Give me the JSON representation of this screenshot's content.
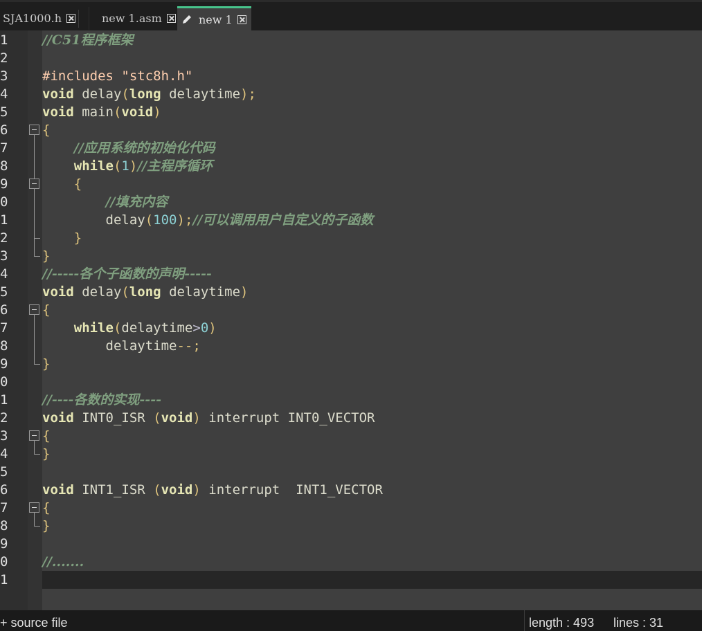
{
  "tabs": [
    {
      "label": "SJA1000.h",
      "active": false
    },
    {
      "label": "new 1.asm",
      "active": false
    },
    {
      "label": "new 1",
      "active": true
    }
  ],
  "editor": {
    "line_numbers": [
      "1",
      "2",
      "3",
      "4",
      "5",
      "6",
      "7",
      "8",
      "9",
      "0",
      "1",
      "2",
      "3",
      "4",
      "5",
      "6",
      "7",
      "8",
      "9",
      "0",
      "1",
      "2",
      "3",
      "4",
      "5",
      "6",
      "7",
      "8",
      "9",
      "0",
      "1"
    ],
    "lines": [
      [
        {
          "t": "//C51程序框架",
          "c": "cmserif"
        }
      ],
      [],
      [
        {
          "t": "#includes ",
          "c": "pp"
        },
        {
          "t": "\"stc8h.h\"",
          "c": "pp"
        }
      ],
      [
        {
          "t": "void",
          "c": "kw"
        },
        {
          "t": " delay",
          "c": "id"
        },
        {
          "t": "(",
          "c": "br"
        },
        {
          "t": "long",
          "c": "kw"
        },
        {
          "t": " delaytime",
          "c": "id"
        },
        {
          "t": ");",
          "c": "br"
        }
      ],
      [
        {
          "t": "void",
          "c": "kw"
        },
        {
          "t": " main",
          "c": "id"
        },
        {
          "t": "(",
          "c": "br"
        },
        {
          "t": "void",
          "c": "kw"
        },
        {
          "t": ")",
          "c": "br"
        }
      ],
      [
        {
          "t": "{",
          "c": "br"
        }
      ],
      [
        {
          "t": "    ",
          "c": "id"
        },
        {
          "t": "//应用系统的初始化代码",
          "c": "cmserif"
        }
      ],
      [
        {
          "t": "    ",
          "c": "id"
        },
        {
          "t": "while",
          "c": "kw"
        },
        {
          "t": "(",
          "c": "br"
        },
        {
          "t": "1",
          "c": "num"
        },
        {
          "t": ")",
          "c": "br"
        },
        {
          "t": "//主程序循环",
          "c": "cmserif"
        }
      ],
      [
        {
          "t": "    ",
          "c": "id"
        },
        {
          "t": "{",
          "c": "br"
        }
      ],
      [
        {
          "t": "        ",
          "c": "id"
        },
        {
          "t": "//填充内容",
          "c": "cmserif"
        }
      ],
      [
        {
          "t": "        delay",
          "c": "id"
        },
        {
          "t": "(",
          "c": "br"
        },
        {
          "t": "100",
          "c": "num"
        },
        {
          "t": ");",
          "c": "br"
        },
        {
          "t": "//可以调用用户自定义的子函数",
          "c": "cmserif"
        }
      ],
      [
        {
          "t": "    ",
          "c": "id"
        },
        {
          "t": "}",
          "c": "br"
        }
      ],
      [
        {
          "t": "}",
          "c": "br"
        }
      ],
      [
        {
          "t": "//-----各个子函数的声明-----",
          "c": "cmserif"
        }
      ],
      [
        {
          "t": "void",
          "c": "kw"
        },
        {
          "t": " delay",
          "c": "id"
        },
        {
          "t": "(",
          "c": "br"
        },
        {
          "t": "long",
          "c": "kw"
        },
        {
          "t": " delaytime",
          "c": "id"
        },
        {
          "t": ")",
          "c": "br"
        }
      ],
      [
        {
          "t": "{",
          "c": "br"
        }
      ],
      [
        {
          "t": "    ",
          "c": "id"
        },
        {
          "t": "while",
          "c": "kw"
        },
        {
          "t": "(",
          "c": "br"
        },
        {
          "t": "delaytime",
          "c": "id"
        },
        {
          "t": ">",
          "c": "op"
        },
        {
          "t": "0",
          "c": "num"
        },
        {
          "t": ")",
          "c": "br"
        }
      ],
      [
        {
          "t": "        delaytime",
          "c": "id"
        },
        {
          "t": "--;",
          "c": "br"
        }
      ],
      [
        {
          "t": "}",
          "c": "br"
        }
      ],
      [],
      [
        {
          "t": "//----各数的实现----",
          "c": "cmserif"
        }
      ],
      [
        {
          "t": "void",
          "c": "kw"
        },
        {
          "t": " INT0_ISR ",
          "c": "id"
        },
        {
          "t": "(",
          "c": "br"
        },
        {
          "t": "void",
          "c": "kw"
        },
        {
          "t": ")",
          "c": "br"
        },
        {
          "t": " interrupt INT0_VECTOR",
          "c": "id"
        }
      ],
      [
        {
          "t": "{",
          "c": "br"
        }
      ],
      [
        {
          "t": "}",
          "c": "br"
        }
      ],
      [],
      [
        {
          "t": "void",
          "c": "kw"
        },
        {
          "t": " INT1_ISR ",
          "c": "id"
        },
        {
          "t": "(",
          "c": "br"
        },
        {
          "t": "void",
          "c": "kw"
        },
        {
          "t": ")",
          "c": "br"
        },
        {
          "t": " interrupt  INT1_VECTOR",
          "c": "id"
        }
      ],
      [
        {
          "t": "{",
          "c": "br"
        }
      ],
      [
        {
          "t": "}",
          "c": "br"
        }
      ],
      [],
      [
        {
          "t": "//.......",
          "c": "cmserif"
        }
      ],
      []
    ]
  },
  "status": {
    "file_type": "+ source file",
    "length": "length : 493",
    "lines": "lines : 31"
  }
}
